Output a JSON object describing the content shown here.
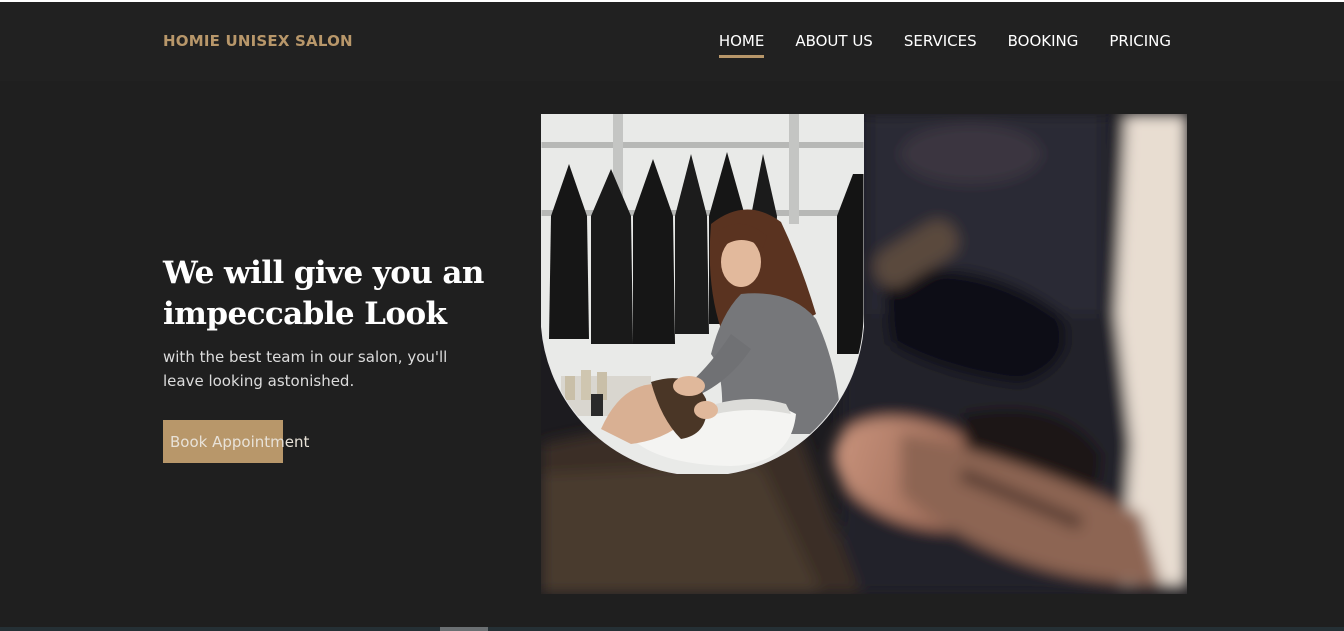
{
  "header": {
    "brand": "HOMIE UNISEX SALON",
    "nav": [
      {
        "label": "HOME",
        "active": true
      },
      {
        "label": "ABOUT US",
        "active": false
      },
      {
        "label": "SERVICES",
        "active": false
      },
      {
        "label": "BOOKING",
        "active": false
      },
      {
        "label": "PRICING",
        "active": false
      }
    ]
  },
  "hero": {
    "title_line1": "We will give you an",
    "title_line2": "impeccable Look",
    "subtitle_line1": "with the best team in our salon, you'll",
    "subtitle_line2": "leave looking astonished.",
    "button_label": "Book Appointment"
  },
  "images": {
    "background": "blurred-salon-photo",
    "inset": "hair-washing-photo"
  },
  "colors": {
    "accent": "#b8976a",
    "background": "#1f1f1f",
    "navbar": "#212121",
    "text": "#ffffff"
  }
}
